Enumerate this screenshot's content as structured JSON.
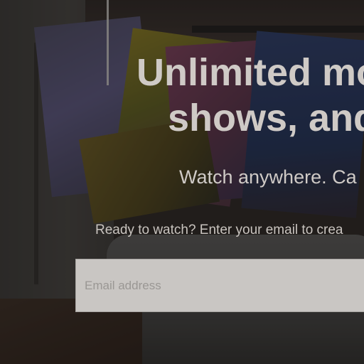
{
  "hero": {
    "title_line1": "Unlimited mo",
    "title_line2": "shows, and",
    "subtitle": "Watch anywhere. Ca",
    "cta_text": "Ready to watch? Enter your email to crea"
  },
  "signup": {
    "email_placeholder": "Email address",
    "email_value": ""
  },
  "colors": {
    "text": "#cfcac6",
    "input_background": "#c9c6c3",
    "overlay": "rgba(0,0,0,0.42)"
  }
}
